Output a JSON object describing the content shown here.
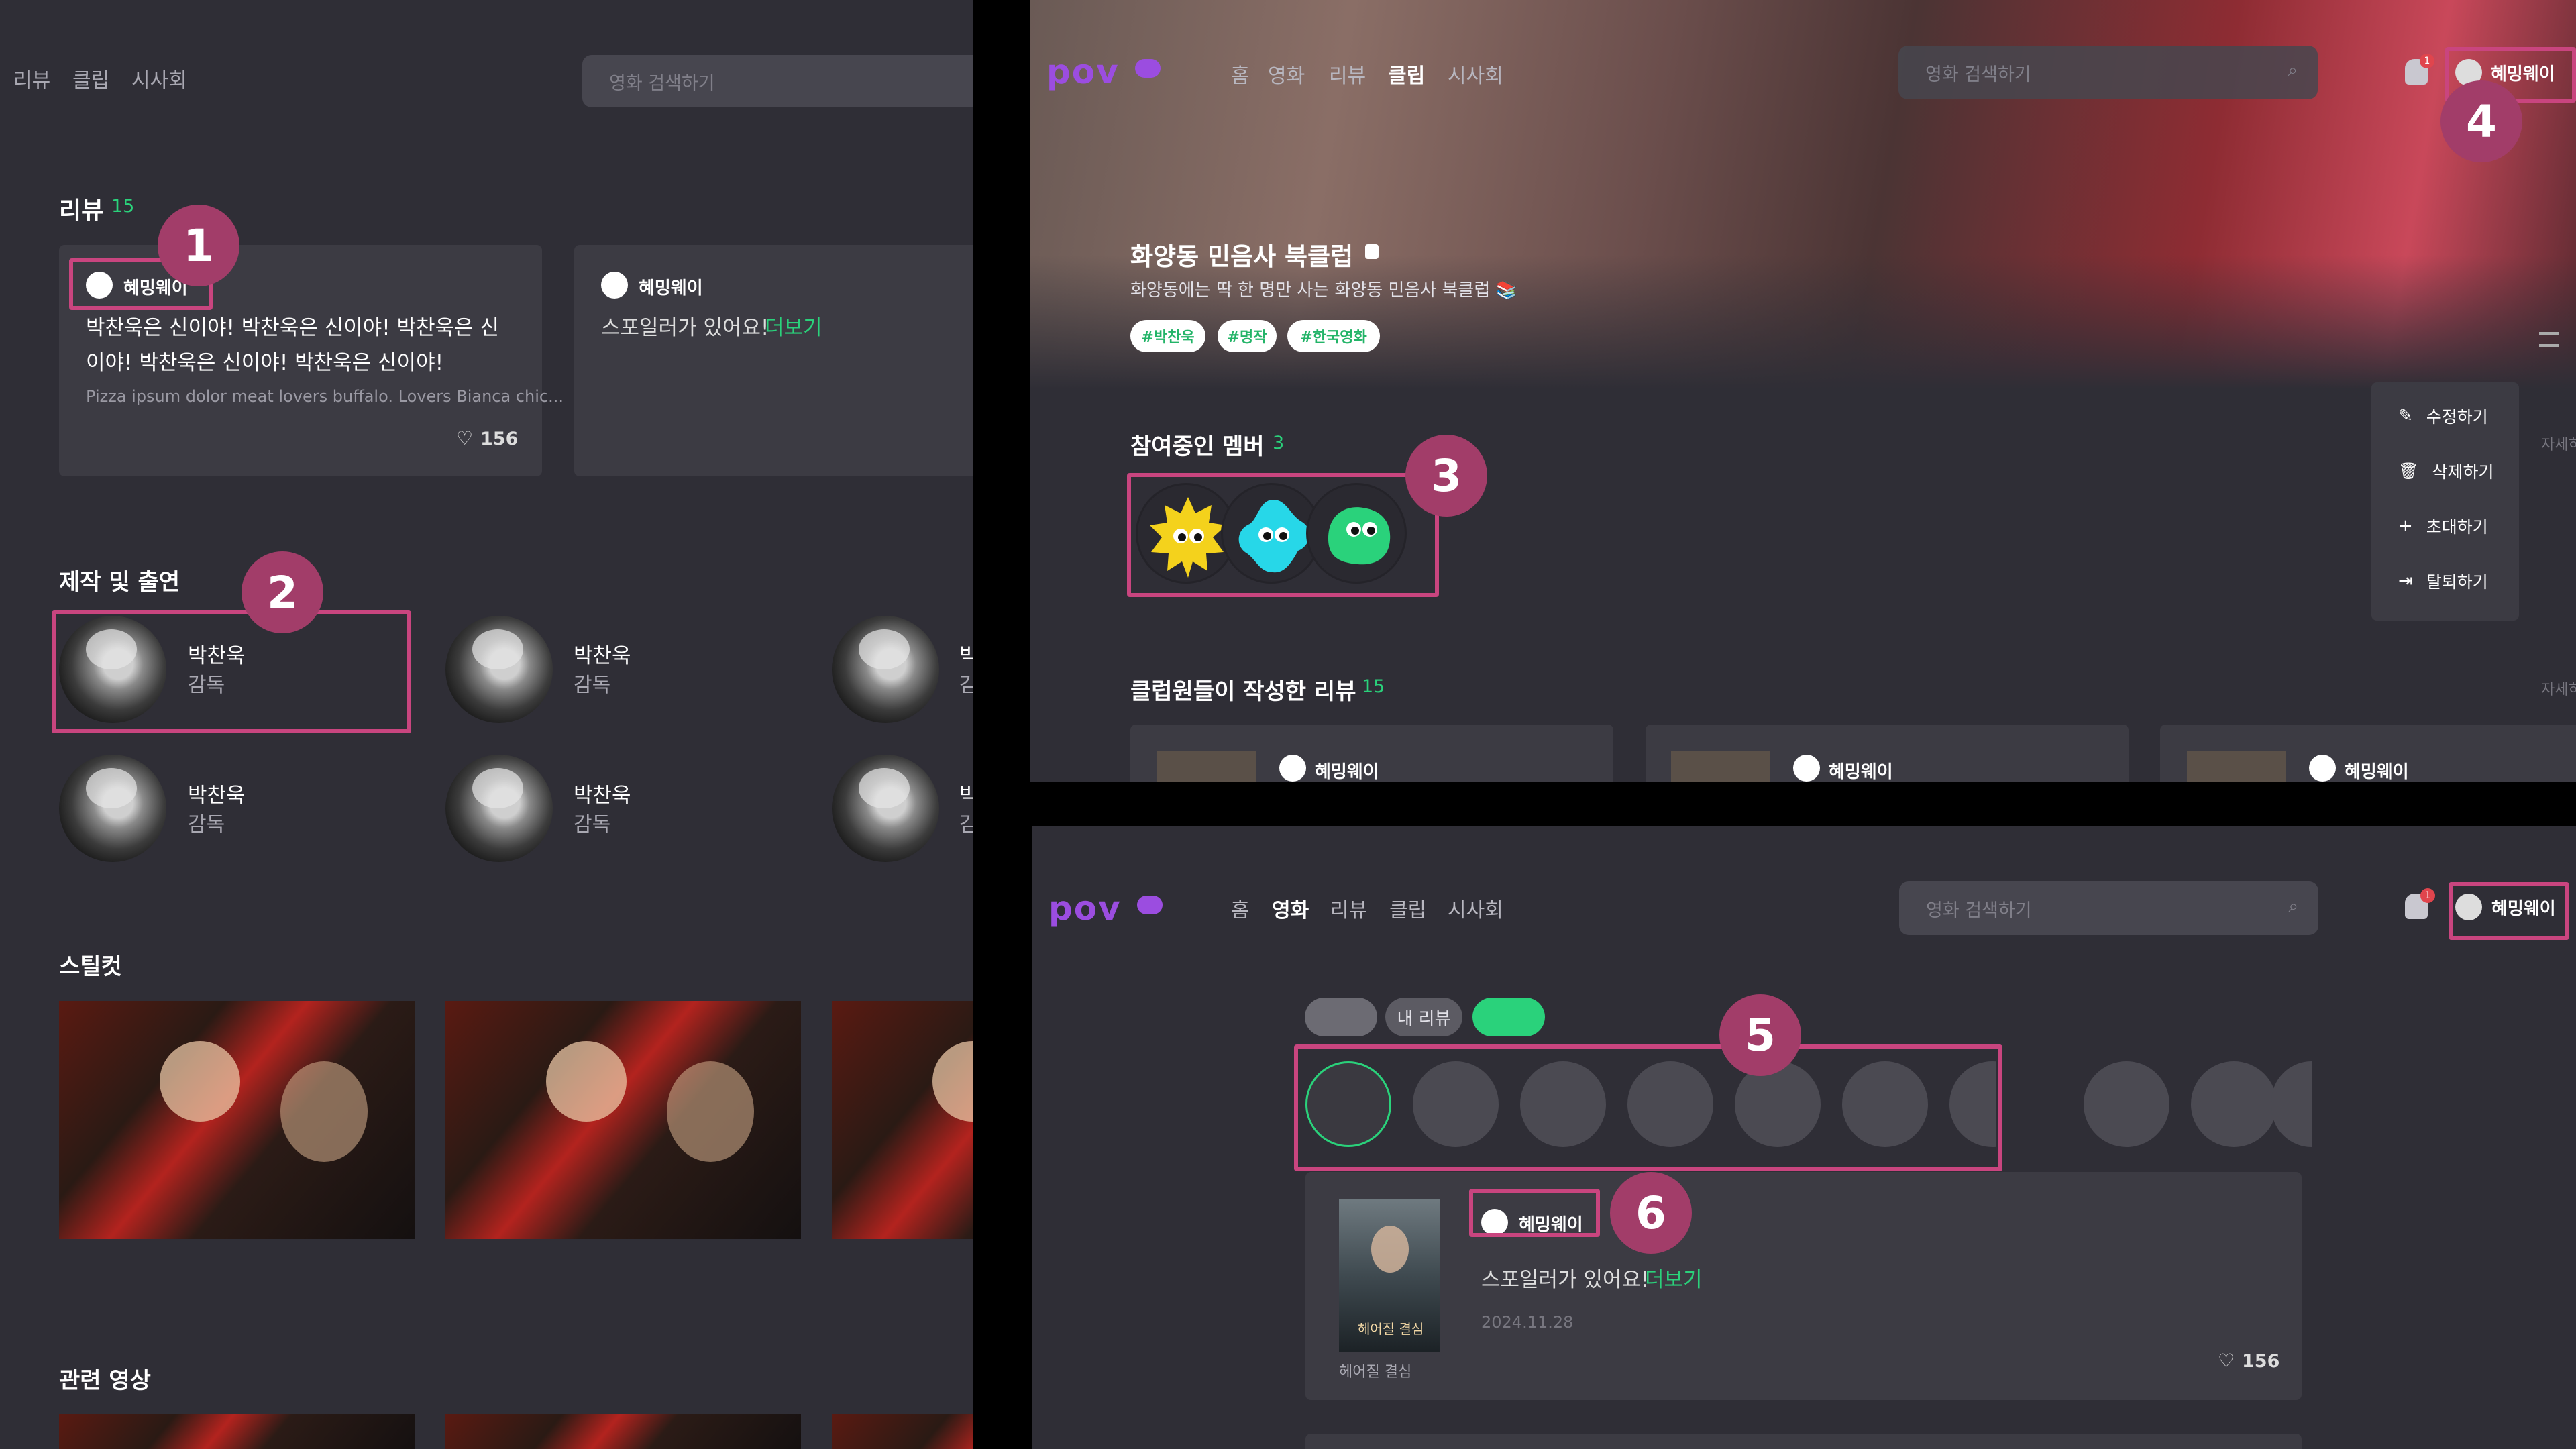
{
  "left_panel": {
    "nav": [
      "리뷰",
      "클립",
      "시사회"
    ],
    "search_placeholder": "영화 검색하기",
    "reviews_section": {
      "title": "리뷰",
      "count": "15"
    },
    "review_cards": [
      {
        "user": "혜밍웨이",
        "text": "박찬욱은 신이야! 박찬욱은 신이야! 박찬욱은 신이야! 박찬욱은 신이야! 박찬욱은 신이야!",
        "snippet": "Pizza ipsum dolor meat lovers buffalo. Lovers Bianca chic...",
        "likes": "156"
      },
      {
        "user": "혜밍웨이",
        "spoiler_text": "스포일러가 있어요!",
        "more": "더보기"
      }
    ],
    "cast_section": {
      "title": "제작 및 출연"
    },
    "cast": [
      {
        "name": "박찬욱",
        "role": "감독"
      },
      {
        "name": "박찬욱",
        "role": "감독"
      },
      {
        "name": "박",
        "role": "감"
      },
      {
        "name": "박찬욱",
        "role": "감독"
      },
      {
        "name": "박찬욱",
        "role": "감독"
      },
      {
        "name": "박",
        "role": "감"
      }
    ],
    "stills_title": "스틸컷",
    "related_title": "관련 영상"
  },
  "top_right": {
    "logo": "pov",
    "nav": [
      "홈",
      "영화",
      "리뷰",
      "클립",
      "시사회"
    ],
    "active_nav": "클립",
    "search_placeholder": "영화 검색하기",
    "user": "혜밍웨이",
    "notification_count": "1",
    "club_name": "화양동 민음사 북클럽",
    "club_desc": "화양동에는 딱 한 명만 사는 화양동 민음사 북클럽 📚",
    "tags": [
      "#박찬욱",
      "#명작",
      "#한국영화"
    ],
    "members_title": "참여중인 멤버",
    "members_count": "3",
    "menu": [
      "수정하기",
      "삭제하기",
      "초대하기",
      "탈퇴하기"
    ],
    "more_link": "자세히",
    "club_reviews_title": "클럽원들이 작성한 리뷰",
    "club_reviews_count": "15",
    "club_review_users": [
      "혜밍웨이",
      "혜밍웨이",
      "혜밍웨이"
    ]
  },
  "bottom_right": {
    "logo": "pov",
    "nav": [
      "홈",
      "영화",
      "리뷰",
      "클립",
      "시사회"
    ],
    "active_nav": "영화",
    "search_placeholder": "영화 검색하기",
    "user": "혜밍웨이",
    "notification_count": "1",
    "filter_chip": "내 리뷰",
    "review": {
      "user": "혜밍웨이",
      "spoiler_text": "스포일러가 있어요!",
      "more": "더보기",
      "date": "2024.11.28",
      "likes": "156",
      "poster_title": "헤어질 결심",
      "poster_caption": "헤어질 결심"
    }
  },
  "badges": [
    "1",
    "2",
    "3",
    "4",
    "5",
    "6"
  ],
  "colors": {
    "accent_green": "#2ad27b",
    "highlight": "#c9457f",
    "badge": "#a23d69",
    "logo": "#9b4de0"
  }
}
